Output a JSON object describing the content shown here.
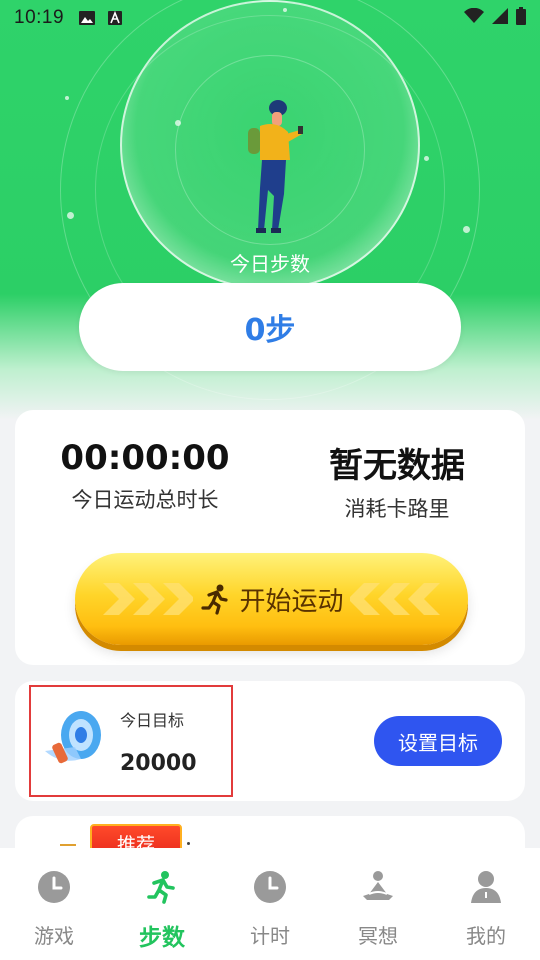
{
  "status_bar": {
    "time": "10:19",
    "icons": [
      "image-icon",
      "text-a-icon",
      "wifi-icon",
      "signal-icon",
      "battery-icon"
    ]
  },
  "hero": {
    "label": "今日步数",
    "steps": "0步"
  },
  "stats": {
    "duration_value": "00:00:00",
    "duration_label": "今日运动总时长",
    "calories_value": "暂无数据",
    "calories_label": "消耗卡路里"
  },
  "start_button": {
    "label": "开始运动",
    "icon": "running-icon"
  },
  "goal": {
    "label": "今日目标",
    "value": "20000",
    "button_label": "设置目标",
    "icon": "megaphone-icon"
  },
  "recommend": {
    "badge": "推荐"
  },
  "tabbar": {
    "items": [
      {
        "label": "游戏",
        "icon": "clock-icon"
      },
      {
        "label": "步数",
        "icon": "running-icon"
      },
      {
        "label": "计时",
        "icon": "clock-icon"
      },
      {
        "label": "冥想",
        "icon": "meditation-icon"
      },
      {
        "label": "我的",
        "icon": "user-icon"
      }
    ],
    "active_index": 1
  },
  "colors": {
    "hero_green": "#2fd36a",
    "steps_blue": "#2f7de6",
    "goal_button": "#2f55f0",
    "active_tab": "#22c45e"
  }
}
